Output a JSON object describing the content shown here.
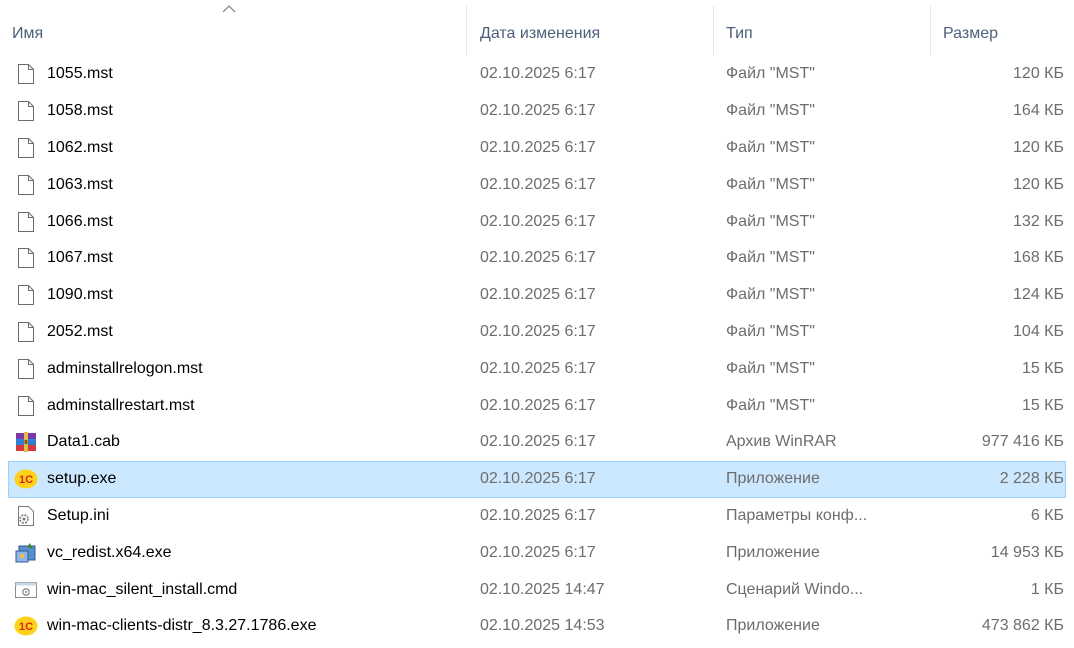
{
  "columns": {
    "name": "Имя",
    "date": "Дата изменения",
    "type": "Тип",
    "size": "Размер"
  },
  "sort": {
    "column": "name",
    "direction": "ascending"
  },
  "selected_row": 11,
  "files": [
    {
      "name": "1055.mst",
      "date": "02.10.2025 6:17",
      "type": "Файл \"MST\"",
      "size": "120 КБ",
      "icon": "document-icon"
    },
    {
      "name": "1058.mst",
      "date": "02.10.2025 6:17",
      "type": "Файл \"MST\"",
      "size": "164 КБ",
      "icon": "document-icon"
    },
    {
      "name": "1062.mst",
      "date": "02.10.2025 6:17",
      "type": "Файл \"MST\"",
      "size": "120 КБ",
      "icon": "document-icon"
    },
    {
      "name": "1063.mst",
      "date": "02.10.2025 6:17",
      "type": "Файл \"MST\"",
      "size": "120 КБ",
      "icon": "document-icon"
    },
    {
      "name": "1066.mst",
      "date": "02.10.2025 6:17",
      "type": "Файл \"MST\"",
      "size": "132 КБ",
      "icon": "document-icon"
    },
    {
      "name": "1067.mst",
      "date": "02.10.2025 6:17",
      "type": "Файл \"MST\"",
      "size": "168 КБ",
      "icon": "document-icon"
    },
    {
      "name": "1090.mst",
      "date": "02.10.2025 6:17",
      "type": "Файл \"MST\"",
      "size": "124 КБ",
      "icon": "document-icon"
    },
    {
      "name": "2052.mst",
      "date": "02.10.2025 6:17",
      "type": "Файл \"MST\"",
      "size": "104 КБ",
      "icon": "document-icon"
    },
    {
      "name": "adminstallrelogon.mst",
      "date": "02.10.2025 6:17",
      "type": "Файл \"MST\"",
      "size": "15 КБ",
      "icon": "document-icon"
    },
    {
      "name": "adminstallrestart.mst",
      "date": "02.10.2025 6:17",
      "type": "Файл \"MST\"",
      "size": "15 КБ",
      "icon": "document-icon"
    },
    {
      "name": "Data1.cab",
      "date": "02.10.2025 6:17",
      "type": "Архив WinRAR",
      "size": "977 416 КБ",
      "icon": "winrar-archive-icon"
    },
    {
      "name": "setup.exe",
      "date": "02.10.2025 6:17",
      "type": "Приложение",
      "size": "2 228 КБ",
      "icon": "1c-app-icon"
    },
    {
      "name": "Setup.ini",
      "date": "02.10.2025 6:17",
      "type": "Параметры конф...",
      "size": "6 КБ",
      "icon": "settings-file-icon"
    },
    {
      "name": "vc_redist.x64.exe",
      "date": "02.10.2025 6:17",
      "type": "Приложение",
      "size": "14 953 КБ",
      "icon": "installer-icon"
    },
    {
      "name": "win-mac_silent_install.cmd",
      "date": "02.10.2025 14:47",
      "type": "Сценарий Windo...",
      "size": "1 КБ",
      "icon": "cmd-script-icon"
    },
    {
      "name": "win-mac-clients-distr_8.3.27.1786.exe",
      "date": "02.10.2025 14:53",
      "type": "Приложение",
      "size": "473 862 КБ",
      "icon": "1c-app-icon"
    }
  ],
  "colors": {
    "header_text": "#4c607a",
    "secondary_text": "#6d6d6d",
    "selection_bg": "#cce8ff",
    "selection_border": "#99d1ff"
  }
}
